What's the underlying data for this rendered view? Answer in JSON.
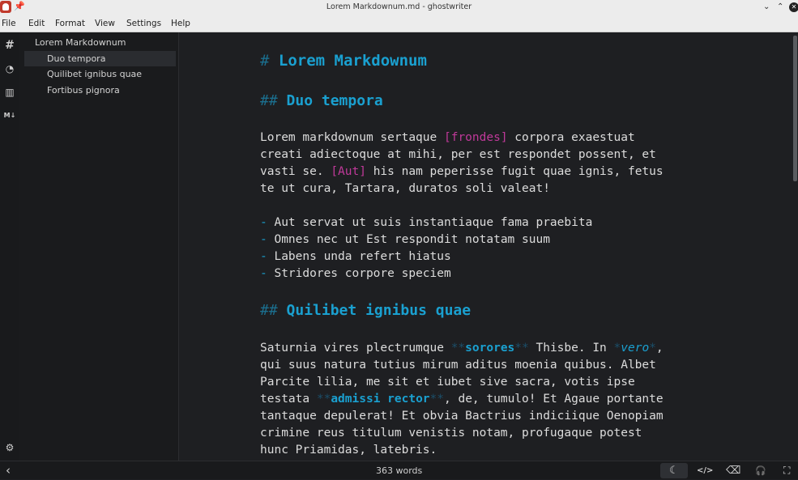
{
  "window": {
    "title": "Lorem Markdownum.md - ghostwriter",
    "pin_glyph": "📌",
    "min_glyph": "⌄",
    "max_glyph": "⌃",
    "close_glyph": "✕"
  },
  "menu": [
    "File",
    "Edit",
    "Format",
    "View",
    "Settings",
    "Help"
  ],
  "iconbar": {
    "outline_glyph": "#",
    "stats_glyph": "◔",
    "chart_glyph": "▥",
    "md_glyph": "M↓",
    "settings_glyph": "⚙"
  },
  "outline": {
    "items": [
      "Lorem Markdownum",
      "Duo tempora",
      "Quilibet ignibus quae",
      "Fortibus pignora"
    ]
  },
  "doc": {
    "h1_mark": "#",
    "h1": "Lorem Markdownum",
    "h2_mark": "##",
    "h2a": "Duo tempora",
    "p1": {
      "l1a": "Lorem markdownum sertaque ",
      "l1link": "[frondes]",
      "l1b": " corpora exaestuat",
      "l2": "creati adiectoque at mihi, per est respondet possent, et",
      "l3a": "vasti se. ",
      "l3link": "[Aut]",
      "l3b": " his nam peperisse fugit quae ignis, fetus",
      "l4": "te ut cura, Tartara, duratos soli valeat!"
    },
    "bullet_mark": "-",
    "list": [
      "Aut servat ut suis instantiaque fama praebita",
      "Omnes nec ut Est respondit notatam suum",
      "Labens unda refert hiatus",
      "Stridores corpore speciem"
    ],
    "h2b": "Quilibet ignibus quae",
    "bold_mark": "**",
    "em_mark": "*",
    "p2": {
      "l1a": "Saturnia vires plectrumque ",
      "l1bold": "sorores",
      "l1b": " Thisbe. In ",
      "l1em": "vero",
      "l1c": ",",
      "l2": "qui suus natura tutius mirum aditus moenia quibus. Albet",
      "l3": "Parcite lilia, me sit et iubet sive sacra, votis ipse",
      "l4a": "testata ",
      "l4bold": "admissi rector",
      "l4b": ", de, tumulo! Et Agaue portante",
      "l5": "tantaque depulerat! Et obvia Bactrius indiciique Oenopiam",
      "l6": "crimine reus titulum venistis notam, profugaque potest",
      "l7": "hunc Priamidas, latebris."
    }
  },
  "status": {
    "toggle_glyph": "‹",
    "word_count": "363 words",
    "moon_glyph": "☾",
    "code_glyph": "</>",
    "clear_glyph": "⌫",
    "audio_glyph": "🎧",
    "fullscreen_glyph": "⛶"
  },
  "colors": {
    "accent": "#1aa0d0",
    "link": "#c0399a",
    "background": "#1e1f22"
  }
}
